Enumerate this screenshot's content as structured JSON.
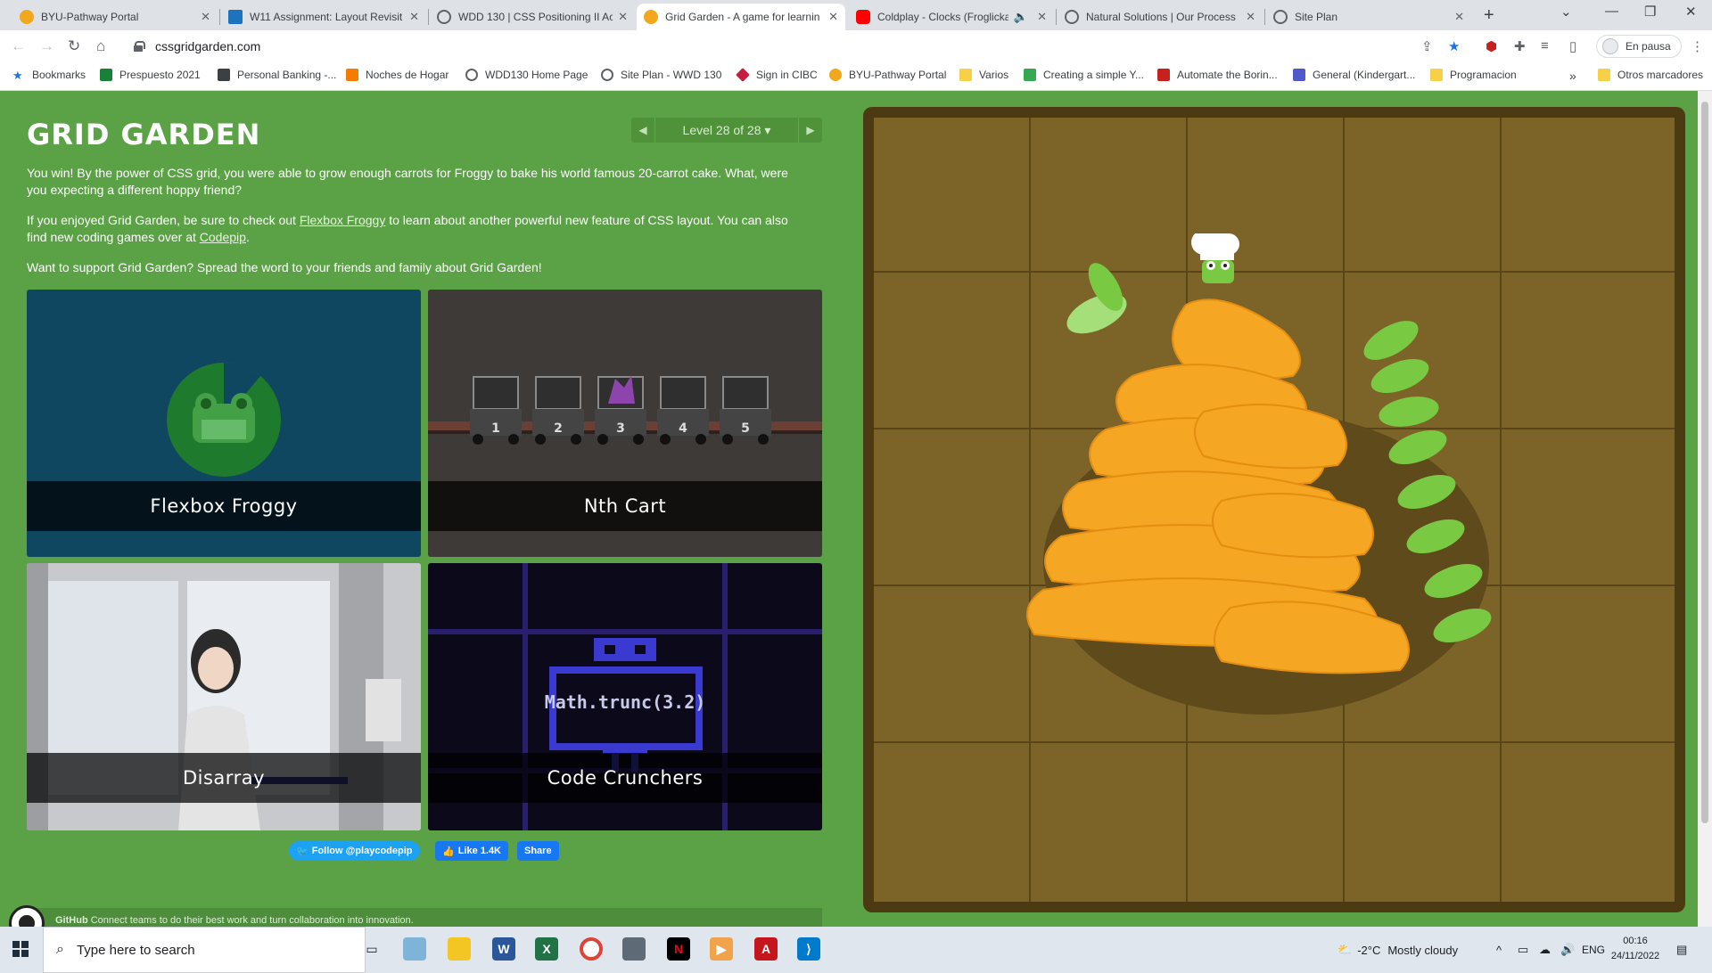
{
  "tabs": [
    {
      "title": "BYU-Pathway Portal",
      "color": "#f2a81d"
    },
    {
      "title": "W11 Assignment: Layout Revisit",
      "color": "#1e73be"
    },
    {
      "title": "WDD 130 | CSS Positioning II Ac",
      "color": "#5f6368"
    },
    {
      "title": "Grid Garden - A game for learnin",
      "color": "#f2a81d",
      "active": true
    },
    {
      "title": "Coldplay - Clocks (Froglicka",
      "color": "#ff0000"
    },
    {
      "title": "Natural Solutions | Our Process",
      "color": "#5f6368"
    },
    {
      "title": "Site Plan",
      "color": "#5f6368"
    }
  ],
  "browser": {
    "url": "cssgridgarden.com",
    "profile_label": "En pausa",
    "new_tab": "+"
  },
  "bookmarks": [
    {
      "label": "Bookmarks",
      "icon": "star-icon",
      "color": "#1a73e8"
    },
    {
      "label": "Prespuesto 2021",
      "icon": "sheets-icon",
      "color": "#188038"
    },
    {
      "label": "Personal Banking -...",
      "icon": "bank-icon",
      "color": "#3c4043"
    },
    {
      "label": "Noches de Hogar",
      "icon": "blogger-icon",
      "color": "#f57c00"
    },
    {
      "label": "WDD130 Home Page",
      "icon": "globe-icon",
      "color": "#5f6368"
    },
    {
      "label": "Site Plan - WWD 130",
      "icon": "globe-icon",
      "color": "#5f6368"
    },
    {
      "label": "Sign in CIBC",
      "icon": "cibc-icon",
      "color": "#c41f3e"
    },
    {
      "label": "BYU-Pathway Portal",
      "icon": "pathway-icon",
      "color": "#f2a81d"
    },
    {
      "label": "Varios",
      "icon": "folder-icon",
      "color": "#f6d046"
    },
    {
      "label": "Creating a simple Y...",
      "icon": "page-icon",
      "color": "#34a853"
    },
    {
      "label": "Automate the Borin...",
      "icon": "book-icon",
      "color": "#c5221f"
    },
    {
      "label": "General (Kindergart...",
      "icon": "teams-icon",
      "color": "#5059c9"
    },
    {
      "label": "Programacion",
      "icon": "folder-icon",
      "color": "#f6d046"
    }
  ],
  "bookmarks_overflow": "»",
  "other_bookmarks": "Otros marcadores",
  "game": {
    "title": "GRID GARDEN",
    "level_label": "Level 28 of 28",
    "level_caret": "▾",
    "prev_arrow": "◀",
    "next_arrow": "▶",
    "win_text": "You win! By the power of CSS grid, you were able to grow enough carrots for Froggy to bake his world famous 20-carrot cake. What, were you expecting a different hoppy friend?",
    "enjoy_1": "If you enjoyed Grid Garden, be sure to check out ",
    "flexbox_link": "Flexbox Froggy",
    "enjoy_2": " to learn about another powerful new feature of CSS layout. You can also find new coding games over at ",
    "codepip_link": "Codepip",
    "enjoy_3": ".",
    "support_text": "Want to support Grid Garden? Spread the word to your friends and family about Grid Garden!",
    "cards": [
      {
        "label": "Flexbox Froggy"
      },
      {
        "label": "Nth Cart",
        "cart_numbers": [
          "1",
          "2",
          "3",
          "4",
          "5"
        ]
      },
      {
        "label": "Disarray"
      },
      {
        "label": "Code Crunchers",
        "code": "Math.trunc(3.2)"
      }
    ],
    "social": {
      "follow": "Follow @playcodepip",
      "like": "Like 1.4K",
      "share": "Share"
    },
    "github_brand": "GitHub",
    "github_text": "Connect teams to do their best work and turn collaboration into innovation."
  },
  "taskbar": {
    "search_placeholder": "Type here to search",
    "weather_temp": "-2°C",
    "weather_desc": "Mostly cloudy",
    "language": "ENG",
    "time": "00:16",
    "date": "24/11/2022"
  },
  "colors": {
    "page_green": "#5ba145",
    "soil": "#7c6327",
    "carrot": "#f5a623",
    "leaf": "#7ac943"
  }
}
